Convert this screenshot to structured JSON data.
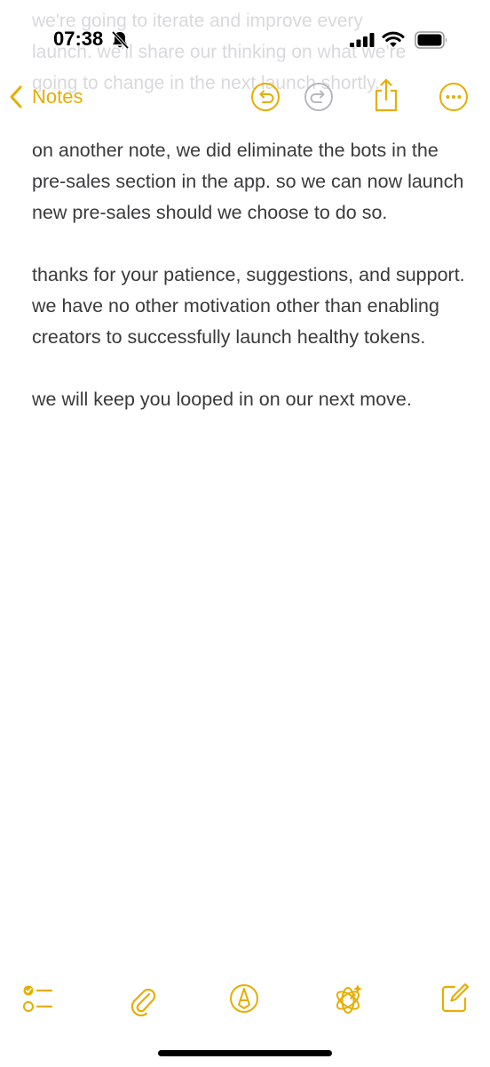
{
  "status_bar": {
    "time": "07:38",
    "icons": [
      "bell-slash-icon",
      "cellular-signal-icon",
      "wifi-icon",
      "battery-icon"
    ]
  },
  "background_text": {
    "line1": "we're going to iterate and improve every",
    "line2": "launch. we'll share our thinking on what we're",
    "line3": "going to change in the next launch shortly."
  },
  "nav": {
    "back_label": "Notes",
    "icons": [
      "undo-icon",
      "redo-icon",
      "share-icon",
      "more-icon"
    ]
  },
  "note": {
    "paragraphs": [
      "on another note, we did eliminate the bots in the pre-sales section in the app. so we can now launch new pre-sales should we choose to do so.",
      "thanks for your patience, suggestions, and support. we have no other motivation other than enabling creators to successfully launch healthy tokens.",
      "we will keep you looped in on our next move."
    ]
  },
  "toolbar": {
    "icons": [
      "checklist-icon",
      "paperclip-icon",
      "markup-pen-icon",
      "apple-intelligence-icon",
      "compose-icon"
    ]
  },
  "colors": {
    "accent": "#e5ae00",
    "text": "#3a3a3c",
    "disabled": "#b8b8bc"
  }
}
